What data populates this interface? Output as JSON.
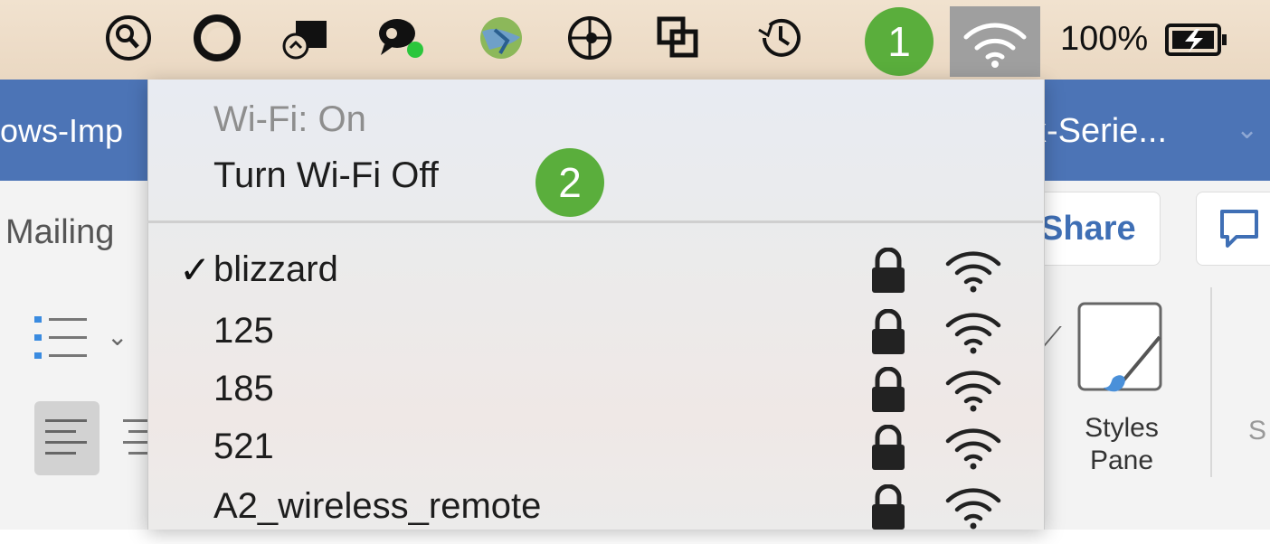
{
  "menubar": {
    "icons": [
      "search-icon",
      "circle-app-icon",
      "camera-app-icon",
      "chat-bubble-icon",
      "network-globe-icon",
      "target-icon",
      "window-copy-icon",
      "time-machine-icon"
    ],
    "battery_text": "100%",
    "wifi_icon": "wifi-icon",
    "background_color": "#ecdcc8"
  },
  "badges": {
    "step1": "1",
    "step2": "2",
    "color": "#5aae3c"
  },
  "word": {
    "doc_title_left": "ows-Imp",
    "doc_title_right": "x-Serie...",
    "tab_mailings": "Mailing",
    "share_label": "Share",
    "styles_pane_line1": "Styles",
    "styles_pane_line2": "Pane",
    "right_cutoff": "S",
    "titlebar_color": "#4c74b6"
  },
  "wifi_menu": {
    "status": "Wi-Fi: On",
    "toggle_label": "Turn Wi-Fi Off",
    "networks": [
      {
        "name": "blizzard",
        "checked": "✓"
      },
      {
        "name": "125",
        "checked": ""
      },
      {
        "name": "185",
        "checked": ""
      },
      {
        "name": "521",
        "checked": ""
      },
      {
        "name": "A2_wireless_remote",
        "checked": ""
      }
    ]
  }
}
